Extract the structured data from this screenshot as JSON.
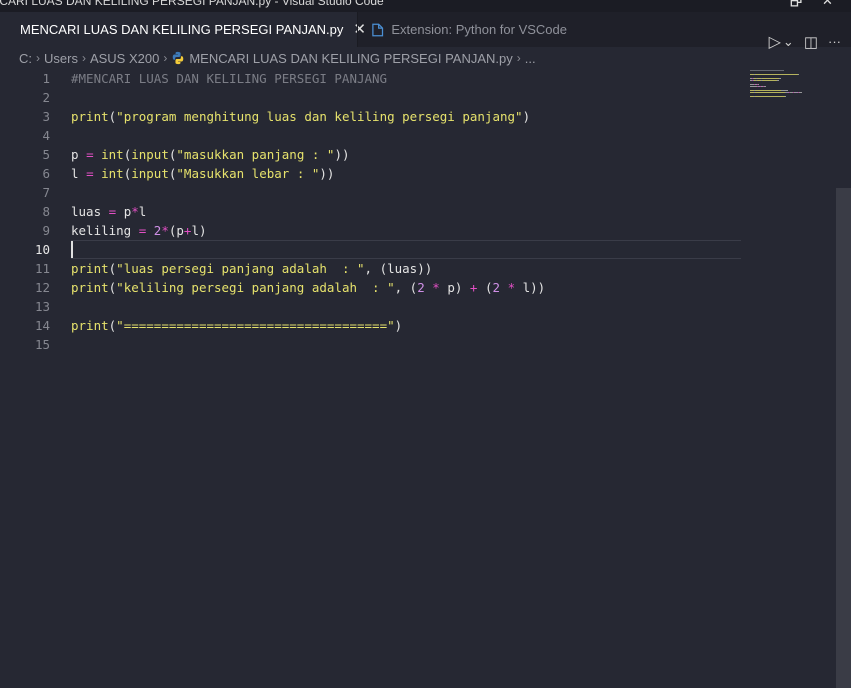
{
  "window": {
    "title": "ICARI LUAS DAN KELILING PERSEGI PANJAN.py - Visual Studio Code",
    "minimize_glyph": "🗗",
    "close_glyph": "✕"
  },
  "tabs": [
    {
      "label": "MENCARI LUAS DAN KELILING PERSEGI PANJAN.py",
      "icon": "python-icon",
      "active": true,
      "close": "✕"
    },
    {
      "label": "Extension: Python for VSCode",
      "icon": "extension-icon",
      "active": false
    }
  ],
  "editor_actions": {
    "run_glyph": "▷",
    "run_dropdown_glyph": "⌄",
    "split_glyph": "◫",
    "more_glyph": "···"
  },
  "breadcrumb": [
    "C:",
    "Users",
    "ASUS X200",
    "MENCARI LUAS DAN KELILING PERSEGI PANJAN.py",
    "..."
  ],
  "breadcrumb_sep": "›",
  "current_line": 10,
  "line_numbers": [
    "1",
    "2",
    "3",
    "4",
    "5",
    "6",
    "7",
    "8",
    "9",
    "10",
    "11",
    "12",
    "13",
    "14",
    "15"
  ],
  "code_lines": [
    [
      {
        "t": "c",
        "v": "#MENCARI LUAS DAN KELILING PERSEGI PANJANG"
      }
    ],
    [],
    [
      {
        "t": "f",
        "v": "print"
      },
      {
        "t": "v",
        "v": "("
      },
      {
        "t": "s",
        "v": "\"program menghitung luas dan keliling persegi panjang\""
      },
      {
        "t": "v",
        "v": ")"
      }
    ],
    [],
    [
      {
        "t": "v",
        "v": "p "
      },
      {
        "t": "o",
        "v": "="
      },
      {
        "t": "v",
        "v": " "
      },
      {
        "t": "f",
        "v": "int"
      },
      {
        "t": "v",
        "v": "("
      },
      {
        "t": "f",
        "v": "input"
      },
      {
        "t": "v",
        "v": "("
      },
      {
        "t": "s",
        "v": "\"masukkan panjang : \""
      },
      {
        "t": "v",
        "v": "))"
      }
    ],
    [
      {
        "t": "v",
        "v": "l "
      },
      {
        "t": "o",
        "v": "="
      },
      {
        "t": "v",
        "v": " "
      },
      {
        "t": "f",
        "v": "int"
      },
      {
        "t": "v",
        "v": "("
      },
      {
        "t": "f",
        "v": "input"
      },
      {
        "t": "v",
        "v": "("
      },
      {
        "t": "s",
        "v": "\"Masukkan lebar : \""
      },
      {
        "t": "v",
        "v": "))"
      }
    ],
    [],
    [
      {
        "t": "v",
        "v": "luas "
      },
      {
        "t": "o",
        "v": "="
      },
      {
        "t": "v",
        "v": " p"
      },
      {
        "t": "o",
        "v": "*"
      },
      {
        "t": "v",
        "v": "l"
      }
    ],
    [
      {
        "t": "v",
        "v": "keliling "
      },
      {
        "t": "o",
        "v": "="
      },
      {
        "t": "v",
        "v": " "
      },
      {
        "t": "n",
        "v": "2"
      },
      {
        "t": "o",
        "v": "*"
      },
      {
        "t": "v",
        "v": "(p"
      },
      {
        "t": "o",
        "v": "+"
      },
      {
        "t": "v",
        "v": "l)"
      }
    ],
    [],
    [
      {
        "t": "f",
        "v": "print"
      },
      {
        "t": "v",
        "v": "("
      },
      {
        "t": "s",
        "v": "\"luas persegi panjang adalah  : \""
      },
      {
        "t": "v",
        "v": ", (luas))"
      }
    ],
    [
      {
        "t": "f",
        "v": "print"
      },
      {
        "t": "v",
        "v": "("
      },
      {
        "t": "s",
        "v": "\"keliling persegi panjang adalah  : \""
      },
      {
        "t": "v",
        "v": ", ("
      },
      {
        "t": "n",
        "v": "2"
      },
      {
        "t": "v",
        "v": " "
      },
      {
        "t": "o",
        "v": "*"
      },
      {
        "t": "v",
        "v": " p) "
      },
      {
        "t": "o",
        "v": "+"
      },
      {
        "t": "v",
        "v": " ("
      },
      {
        "t": "n",
        "v": "2"
      },
      {
        "t": "v",
        "v": " "
      },
      {
        "t": "o",
        "v": "*"
      },
      {
        "t": "v",
        "v": " l))"
      }
    ],
    [],
    [
      {
        "t": "f",
        "v": "print"
      },
      {
        "t": "v",
        "v": "("
      },
      {
        "t": "s",
        "v": "\"===================================\""
      },
      {
        "t": "v",
        "v": ")"
      }
    ],
    []
  ],
  "colors": {
    "comment": "#7b7d86",
    "function": "#e6e26c",
    "string": "#e6e26c",
    "operator": "#e34fc5",
    "number": "#cf8fe6",
    "background": "#262833"
  }
}
